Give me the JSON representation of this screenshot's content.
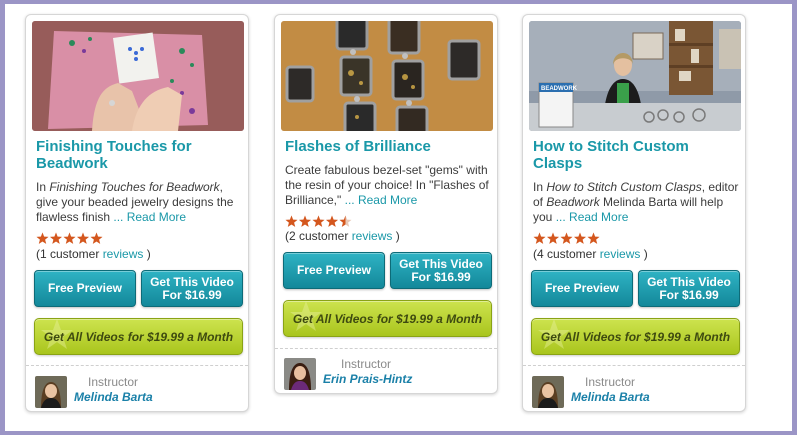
{
  "colors": {
    "frame": "#9b95c6",
    "accent": "#1a98a8",
    "teal_button": "#1fa0b2",
    "green_button": "#bcd434",
    "star": "#d4571e"
  },
  "cards": [
    {
      "title": "Finishing Touches for Beadwork",
      "desc_prefix": "In ",
      "desc_italic": "Finishing Touches for Beadwork",
      "desc_rest": ", give your beaded jewelry designs the flawless finish ",
      "desc_mid_italic": "",
      "desc_tail": "",
      "read_more": "... Read More",
      "rating": 5,
      "reviews_prefix": "(1 customer ",
      "reviews_link": "reviews",
      "reviews_suffix": " )",
      "preview_label": "Free Preview",
      "buy_line1": "Get This Video",
      "buy_line2": "For $16.99",
      "all_videos_label": "Get All Videos for $19.99 a Month",
      "instructor_label": "Instructor",
      "instructor_name": "Melinda Barta"
    },
    {
      "title": "Flashes of Brilliance",
      "desc_prefix": "Create fabulous bezel-set \"gems\" with the resin of your choice! In \"Flashes of Brilliance,\" ",
      "desc_italic": "",
      "desc_rest": "",
      "desc_mid_italic": "",
      "desc_tail": "",
      "read_more": "... Read More",
      "rating": 4.5,
      "reviews_prefix": "(2 customer ",
      "reviews_link": "reviews",
      "reviews_suffix": " )",
      "preview_label": "Free Preview",
      "buy_line1": "Get This Video",
      "buy_line2": "For $16.99",
      "all_videos_label": "Get All Videos for $19.99 a Month",
      "instructor_label": "Instructor",
      "instructor_name": "Erin Prais-Hintz"
    },
    {
      "title": "How to Stitch Custom Clasps",
      "desc_prefix": "In ",
      "desc_italic": "How to Stitch Custom Clasps",
      "desc_rest": ", editor of ",
      "desc_mid_italic": "Beadwork",
      "desc_tail": " Melinda Barta will help you ",
      "read_more": "... Read More",
      "rating": 5,
      "reviews_prefix": "(4 customer ",
      "reviews_link": "reviews",
      "reviews_suffix": " )",
      "preview_label": "Free Preview",
      "buy_line1": "Get This Video",
      "buy_line2": "For $16.99",
      "all_videos_label": "Get All Videos for $19.99 a Month",
      "instructor_label": "Instructor",
      "instructor_name": "Melinda Barta",
      "thumb_magazine_text": "BEADWORK"
    }
  ]
}
